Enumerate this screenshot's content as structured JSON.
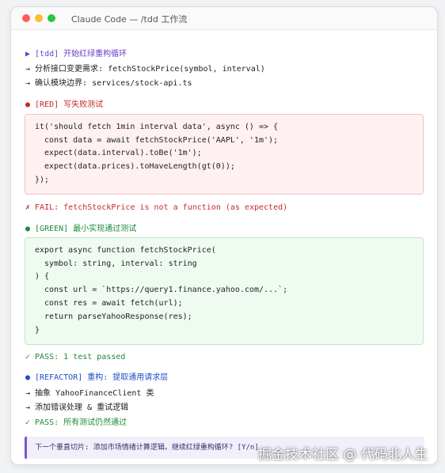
{
  "window": {
    "title": "Claude Code — /tdd 工作流"
  },
  "lines": {
    "tdd_header": "▶ [tdd] 开始红绿重构循环",
    "analyze": "→ 分析接口变更需求: fetchStockPrice(symbol, interval)",
    "confirm": "→ 确认模块边界: services/stock-api.ts",
    "red_header": "● [RED] 写失败测试",
    "fail": "✗ FAIL: fetchStockPrice is not a function (as expected)",
    "green_header": "● [GREEN] 最小实现通过测试",
    "pass1": "✓ PASS: 1 test passed",
    "refactor_header": "● [REFACTOR] 重构: 提取通用请求层",
    "extract": "→ 抽象 YahooFinanceClient 类",
    "add_error": "→ 添加错误处理 & 重试逻辑",
    "pass_all": "✓ PASS: 所有测试仍然通过"
  },
  "red_code": [
    "it('should fetch 1min interval data', async () => {",
    "  const data = await fetchStockPrice('AAPL', '1m');",
    "  expect(data.interval).toBe('1m');",
    "  expect(data.prices).toHaveLength(gt(0));",
    "});"
  ],
  "green_code": [
    "export async function fetchStockPrice(",
    "  symbol: string, interval: string",
    ") {",
    "  const url = `https://query1.finance.yahoo.com/...`;",
    "  const res = await fetch(url);",
    "  return parseYahooResponse(res);",
    "}"
  ],
  "prompt": {
    "text": "下一个垂直切片: 添加市场情绪计算逻辑。继续红绿重构循环? [Y/n]"
  },
  "watermark": "掘金技术社区 @ 代码北人生",
  "colors": {
    "tdd": "#6b3fc7",
    "red": "#c62828",
    "green": "#1f8a3a",
    "refactor": "#1f4fc7",
    "red_box_bg": "#fff1f1",
    "green_box_bg": "#effbf1",
    "prompt_bg": "#f2effb"
  }
}
